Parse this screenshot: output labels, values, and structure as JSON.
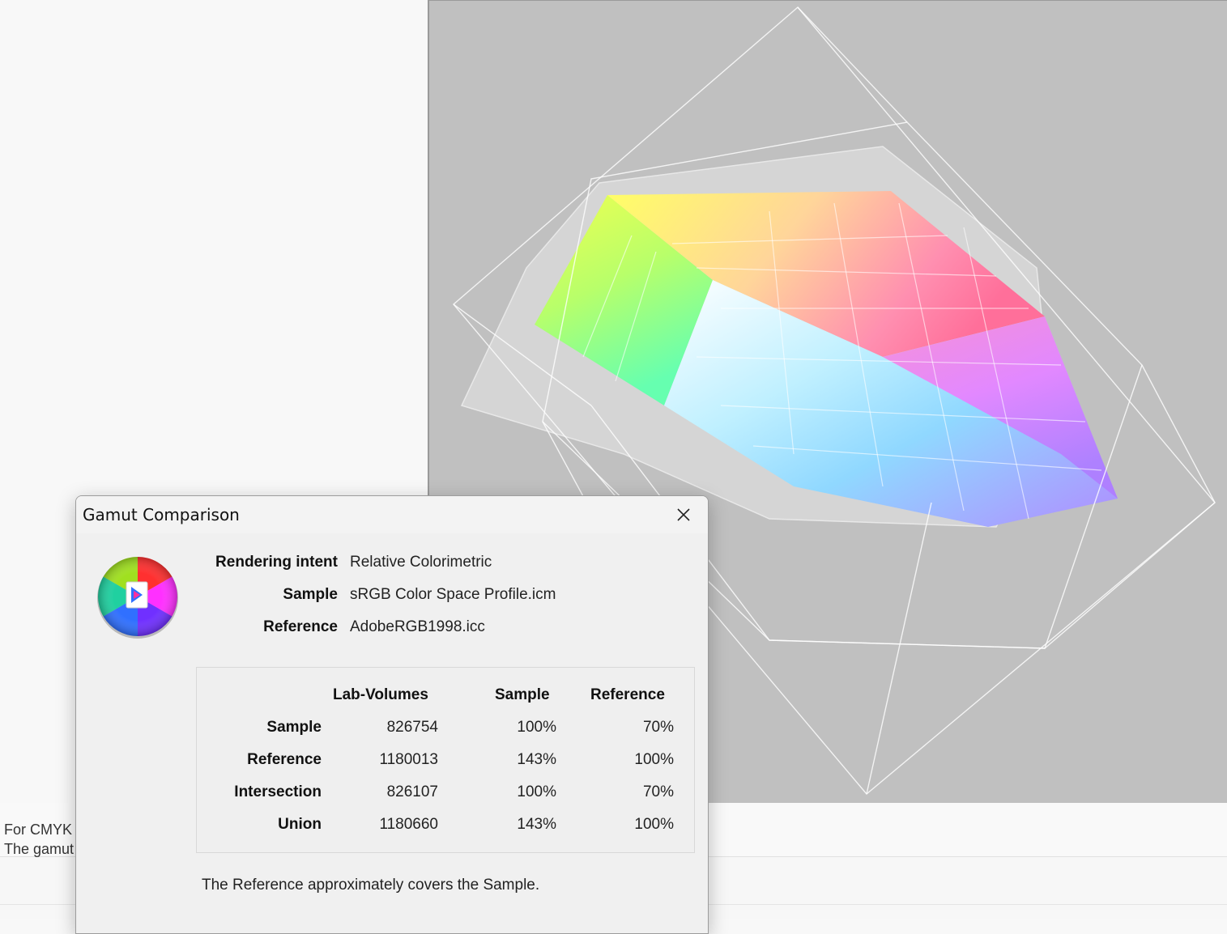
{
  "background": {
    "text_line1": "For CMYK p",
    "text_line2": "The gamut"
  },
  "dialog": {
    "title": "Gamut Comparison",
    "close_icon": "close-icon",
    "logo_icon": "color-wheel-document-icon",
    "rendering_intent_label": "Rendering intent",
    "rendering_intent_value": "Relative Colorimetric",
    "sample_label": "Sample",
    "sample_value": "sRGB Color Space Profile.icm",
    "reference_label": "Reference",
    "reference_value": "AdobeRGB1998.icc",
    "table": {
      "headers": [
        "Lab-Volumes",
        "Sample",
        "Reference"
      ],
      "rows": [
        {
          "label": "Sample",
          "volume": "826754",
          "sample": "100%",
          "reference": "70%"
        },
        {
          "label": "Reference",
          "volume": "1180013",
          "sample": "143%",
          "reference": "100%"
        },
        {
          "label": "Intersection",
          "volume": "826107",
          "sample": "100%",
          "reference": "70%"
        },
        {
          "label": "Union",
          "volume": "1180660",
          "sample": "143%",
          "reference": "100%"
        }
      ]
    },
    "summary": "The Reference approximately covers the Sample."
  },
  "colors": {
    "viewport_bg": "#c0c0c0",
    "dialog_bg": "#f0f0f0"
  }
}
